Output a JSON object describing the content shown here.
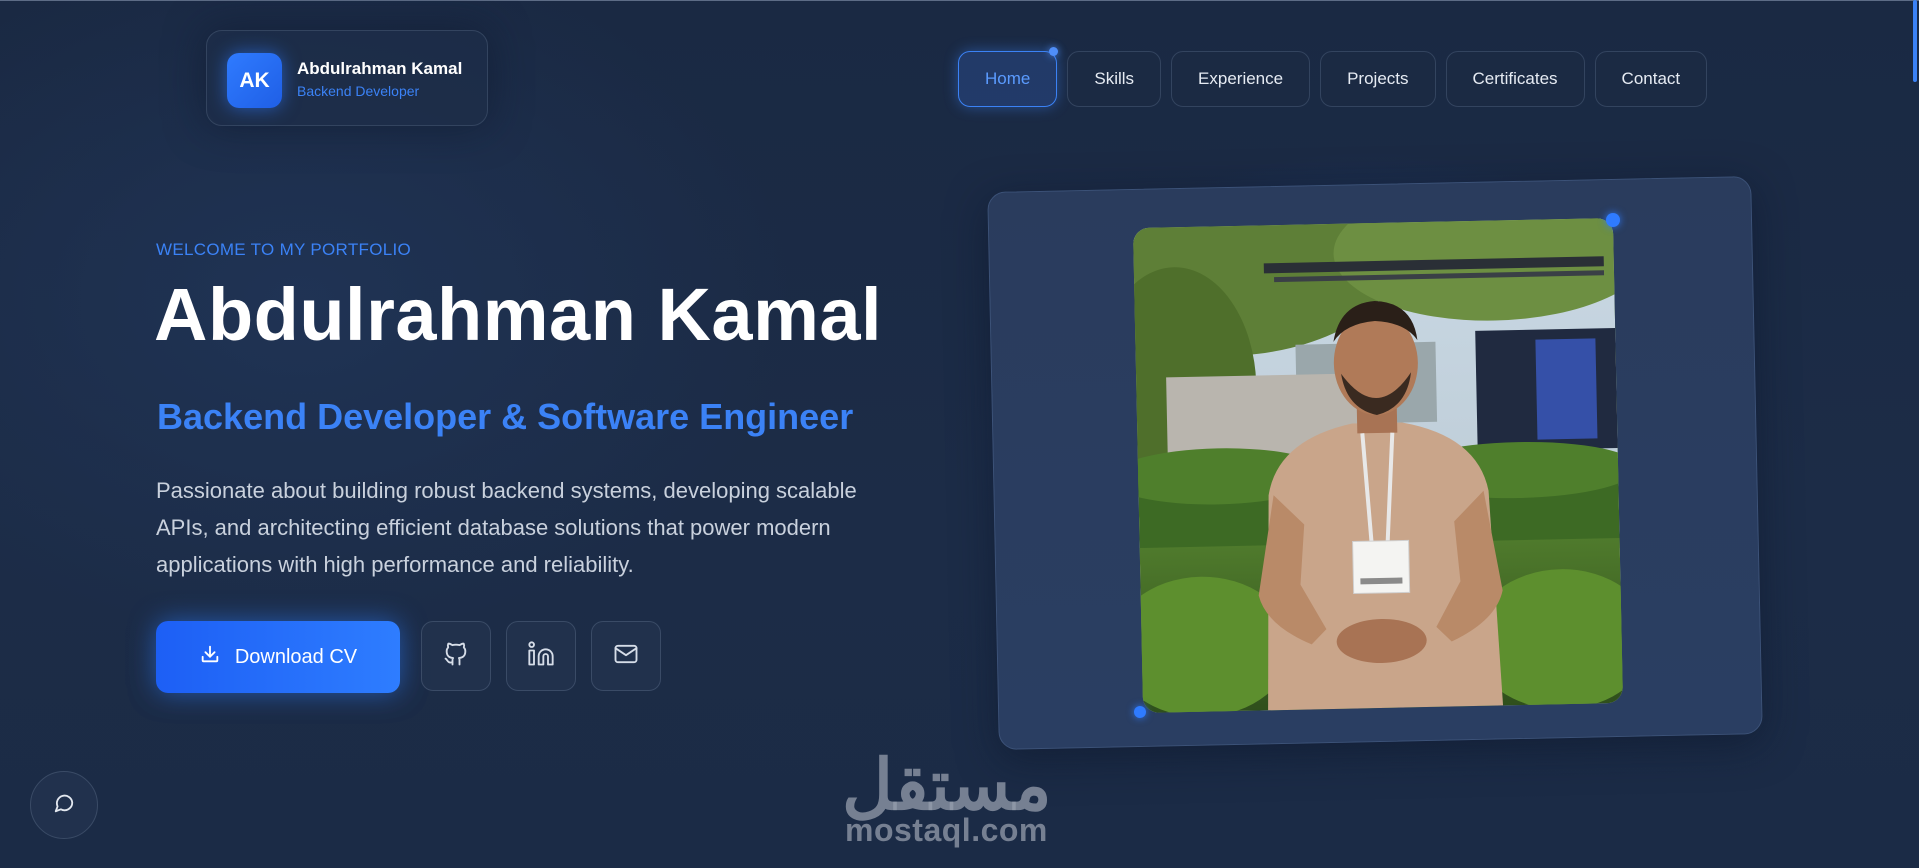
{
  "logo": {
    "initials": "AK",
    "name": "Abdulrahman Kamal",
    "role": "Backend Developer"
  },
  "nav": {
    "items": [
      {
        "label": "Home",
        "active": true
      },
      {
        "label": "Skills"
      },
      {
        "label": "Experience"
      },
      {
        "label": "Projects"
      },
      {
        "label": "Certificates"
      },
      {
        "label": "Contact"
      }
    ]
  },
  "hero": {
    "welcome": "WELCOME TO MY PORTFOLIO",
    "name": "Abdulrahman Kamal",
    "title": "Backend Developer & Software Engineer",
    "description": "Passionate about building robust backend systems, developing scalable APIs, and architecting efficient database solutions that power modern applications with high performance and reliability."
  },
  "actions": {
    "download_cv": "Download CV",
    "social": [
      {
        "icon": "github-icon"
      },
      {
        "icon": "linkedin-icon"
      },
      {
        "icon": "mail-icon"
      }
    ]
  },
  "chat": {
    "icon": "chat-bubble-icon"
  },
  "watermark": {
    "arabic": "مستقل",
    "latin": "mostaql.com"
  },
  "colors": {
    "background": "#1b2a44",
    "accent": "#3b82f6",
    "text": "#ffffff",
    "muted_text": "#c9d1dd"
  }
}
